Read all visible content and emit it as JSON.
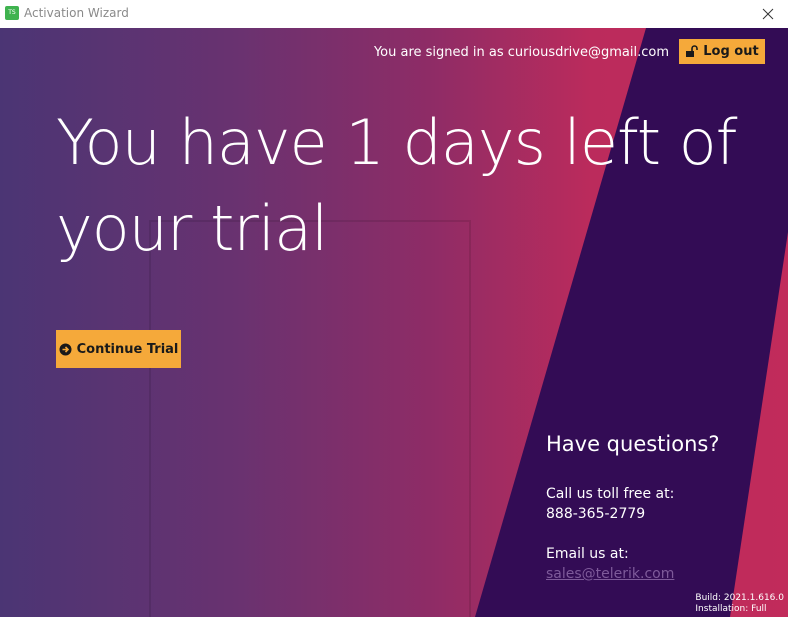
{
  "window": {
    "title": "Activation Wizard",
    "app_icon_text": "TS"
  },
  "account": {
    "signed_in_text": "You are signed in as curiousdrive@gmail.com",
    "logout_label": "Log out"
  },
  "main": {
    "headline": "You have 1 days left of your trial",
    "continue_label": "Continue Trial"
  },
  "questions": {
    "title": "Have questions?",
    "call_label": "Call us toll free at:",
    "phone": "888-365-2779",
    "email_label": "Email us at:",
    "email": "sales@telerik.com"
  },
  "build": {
    "build_text": "Build: 2021.1.616.0",
    "installation_text": "Installation: Full"
  },
  "colors": {
    "accent": "#f5a93a",
    "dark_band": "#330c55",
    "pink": "#c12b5b"
  },
  "icons": {
    "close": "close-icon",
    "logout": "unlock-icon",
    "continue": "arrow-circle-right-icon"
  }
}
